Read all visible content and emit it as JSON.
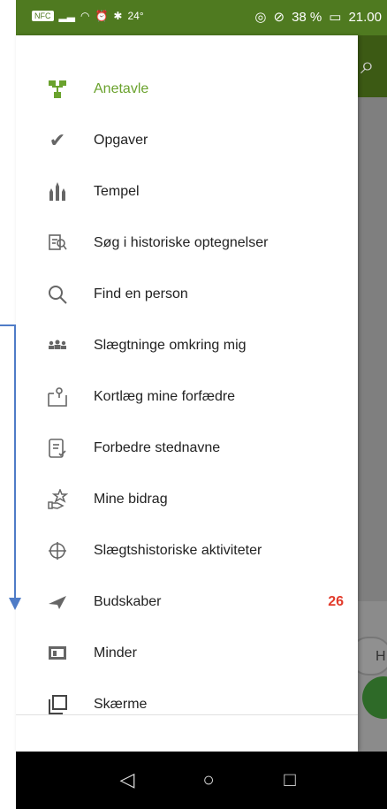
{
  "statusbar": {
    "left_chip": "NFC",
    "left_temp": "24°",
    "battery_pct": "38 %",
    "time": "21.00"
  },
  "background": {
    "pill_text": "H"
  },
  "menu": {
    "items": [
      {
        "label": "Anetavle",
        "icon": "family-tree-icon",
        "active": true
      },
      {
        "label": "Opgaver",
        "icon": "check-icon"
      },
      {
        "label": "Tempel",
        "icon": "temple-icon"
      },
      {
        "label": "Søg i historiske optegnelser",
        "icon": "records-search-icon"
      },
      {
        "label": "Find en person",
        "icon": "search-icon"
      },
      {
        "label": "Slægtninge omkring mig",
        "icon": "people-icon"
      },
      {
        "label": "Kortlæg mine forfædre",
        "icon": "map-pin-icon"
      },
      {
        "label": "Forbedre stednavne",
        "icon": "document-check-icon"
      },
      {
        "label": "Mine bidrag",
        "icon": "hand-star-icon"
      },
      {
        "label": "Slægtshistoriske aktiviteter",
        "icon": "compass-icon"
      },
      {
        "label": "Budskaber",
        "icon": "paper-plane-icon",
        "badge": "26"
      },
      {
        "label": "Minder",
        "icon": "photo-icon"
      },
      {
        "label": "Skærme",
        "icon": "screens-icon"
      }
    ]
  },
  "colors": {
    "statusbar": "#4f7a20",
    "active": "#6aa22d",
    "badge": "#e23b2b",
    "arrow": "#4f7cc7"
  }
}
